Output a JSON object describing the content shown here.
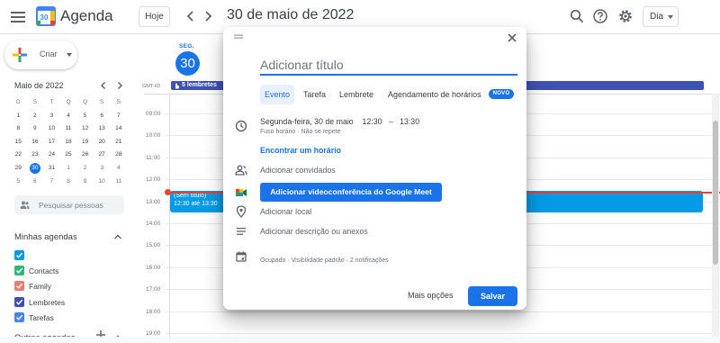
{
  "header": {
    "app_title": "Agenda",
    "logo_day": "30",
    "today_label": "Hoje",
    "date_title": "30 de maio de 2022",
    "view_label": "Dia"
  },
  "sidebar": {
    "create_label": "Criar",
    "mini_calendar": {
      "title": "Maio de 2022",
      "weekdays": [
        "D",
        "S",
        "T",
        "Q",
        "Q",
        "S",
        "S"
      ],
      "weeks": [
        [
          "1",
          "2",
          "3",
          "4",
          "5",
          "6",
          "7"
        ],
        [
          "8",
          "9",
          "10",
          "11",
          "12",
          "13",
          "14"
        ],
        [
          "15",
          "16",
          "17",
          "18",
          "19",
          "20",
          "21"
        ],
        [
          "22",
          "23",
          "24",
          "25",
          "26",
          "27",
          "28"
        ],
        [
          "29",
          "30",
          "31",
          "1",
          "2",
          "3",
          "4"
        ],
        [
          "5",
          "6",
          "7",
          "8",
          "9",
          "10",
          "11"
        ]
      ],
      "selected_day": "30"
    },
    "people_search_placeholder": "Pesquisar pessoas",
    "my_calendars_title": "Minhas agendas",
    "my_calendars": [
      {
        "label": "",
        "color": "#039be5",
        "checked": true
      },
      {
        "label": "Contacts",
        "color": "#33b679",
        "checked": true
      },
      {
        "label": "Family",
        "color": "#e67c73",
        "checked": true
      },
      {
        "label": "Lembretes",
        "color": "#3f51b5",
        "checked": true
      },
      {
        "label": "Tarefas",
        "color": "#4285f4",
        "checked": true
      }
    ],
    "other_calendars_title": "Outras agendas"
  },
  "main": {
    "day_abbr": "SEG.",
    "day_number": "30",
    "timezone": "GMT-03",
    "reminders_label": "5 lembretes",
    "times": [
      "09:00",
      "10:00",
      "11:00",
      "12:00",
      "13:00",
      "14:00",
      "15:00",
      "16:00",
      "17:00",
      "18:00",
      "19:00"
    ],
    "event": {
      "title": "(Sem título)",
      "time": "12:30 até 13:30"
    }
  },
  "dialog": {
    "title_placeholder": "Adicionar título",
    "tabs": [
      "Evento",
      "Tarefa",
      "Lembrete",
      "Agendamento de horários"
    ],
    "new_badge": "NOVO",
    "date_text": "Segunda-feira, 30 de maio",
    "start_time": "12:30",
    "dash": "–",
    "end_time": "13:30",
    "timezone_text": "Fuso horário",
    "separator": "·",
    "repeat_text": "Não se repete",
    "find_time": "Encontrar um horário",
    "add_guests": "Adicionar convidados",
    "meet_button": "Adicionar videoconferência do Google Meet",
    "add_location": "Adicionar local",
    "add_description": "Adicionar descrição ou anexos",
    "status_text": "Ocupado · Visibilidade padrão · 2 notificações",
    "more_options": "Mais opções",
    "save": "Salvar"
  },
  "colors": {
    "accent": "#1a73e8",
    "event": "#039be5",
    "reminder": "#3f51b5",
    "now": "#ea4335"
  }
}
